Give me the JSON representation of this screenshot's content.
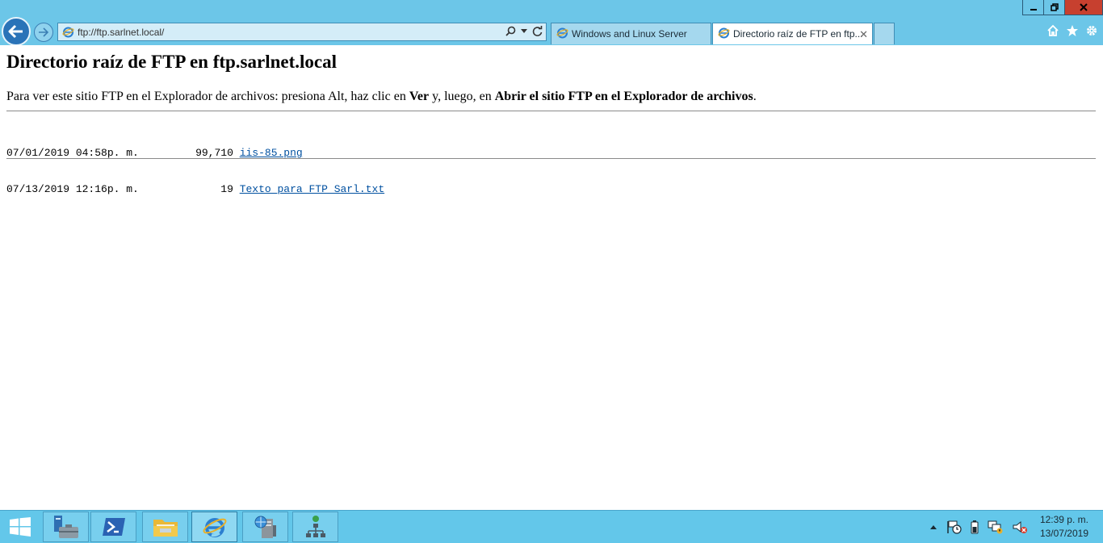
{
  "browser": {
    "address": "ftp://ftp.sarlnet.local/",
    "tabs": [
      {
        "label": "Windows and Linux Server",
        "active": false
      },
      {
        "label": "Directorio raíz de FTP en ftp...",
        "active": true
      }
    ],
    "accent": "#6cc6e8"
  },
  "page": {
    "title": "Directorio raíz de FTP en ftp.sarlnet.local",
    "instructions": {
      "pre": "Para ver este sitio FTP en el Explorador de archivos: presiona Alt, haz clic en ",
      "ver": "Ver",
      "mid": " y, luego, en ",
      "abrir": "Abrir el sitio FTP en el Explorador de archivos",
      "post": "."
    },
    "files": [
      {
        "date": "07/01/2019",
        "time": "04:58p. m.",
        "size": "99,710",
        "name": "iis-85.png"
      },
      {
        "date": "07/13/2019",
        "time": "12:16p. m.",
        "size": "19",
        "name": "Texto para FTP Sarl.txt"
      }
    ]
  },
  "taskbar": {
    "apps": [
      "server-manager-icon",
      "powershell-icon",
      "file-explorer-icon",
      "internet-explorer-icon",
      "iis-manager-icon",
      "network-icon"
    ],
    "clock": {
      "time": "12:39 p. m.",
      "date": "13/07/2019"
    }
  }
}
